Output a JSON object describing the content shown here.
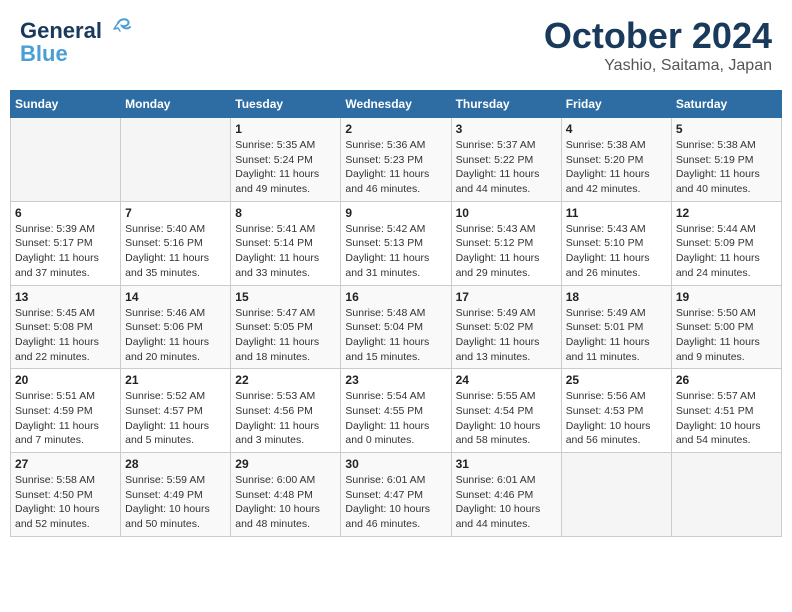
{
  "header": {
    "logo_line1": "General",
    "logo_line2": "Blue",
    "month": "October 2024",
    "location": "Yashio, Saitama, Japan"
  },
  "days_of_week": [
    "Sunday",
    "Monday",
    "Tuesday",
    "Wednesday",
    "Thursday",
    "Friday",
    "Saturday"
  ],
  "weeks": [
    [
      {
        "day": "",
        "info": ""
      },
      {
        "day": "",
        "info": ""
      },
      {
        "day": "1",
        "info": "Sunrise: 5:35 AM\nSunset: 5:24 PM\nDaylight: 11 hours and 49 minutes."
      },
      {
        "day": "2",
        "info": "Sunrise: 5:36 AM\nSunset: 5:23 PM\nDaylight: 11 hours and 46 minutes."
      },
      {
        "day": "3",
        "info": "Sunrise: 5:37 AM\nSunset: 5:22 PM\nDaylight: 11 hours and 44 minutes."
      },
      {
        "day": "4",
        "info": "Sunrise: 5:38 AM\nSunset: 5:20 PM\nDaylight: 11 hours and 42 minutes."
      },
      {
        "day": "5",
        "info": "Sunrise: 5:38 AM\nSunset: 5:19 PM\nDaylight: 11 hours and 40 minutes."
      }
    ],
    [
      {
        "day": "6",
        "info": "Sunrise: 5:39 AM\nSunset: 5:17 PM\nDaylight: 11 hours and 37 minutes."
      },
      {
        "day": "7",
        "info": "Sunrise: 5:40 AM\nSunset: 5:16 PM\nDaylight: 11 hours and 35 minutes."
      },
      {
        "day": "8",
        "info": "Sunrise: 5:41 AM\nSunset: 5:14 PM\nDaylight: 11 hours and 33 minutes."
      },
      {
        "day": "9",
        "info": "Sunrise: 5:42 AM\nSunset: 5:13 PM\nDaylight: 11 hours and 31 minutes."
      },
      {
        "day": "10",
        "info": "Sunrise: 5:43 AM\nSunset: 5:12 PM\nDaylight: 11 hours and 29 minutes."
      },
      {
        "day": "11",
        "info": "Sunrise: 5:43 AM\nSunset: 5:10 PM\nDaylight: 11 hours and 26 minutes."
      },
      {
        "day": "12",
        "info": "Sunrise: 5:44 AM\nSunset: 5:09 PM\nDaylight: 11 hours and 24 minutes."
      }
    ],
    [
      {
        "day": "13",
        "info": "Sunrise: 5:45 AM\nSunset: 5:08 PM\nDaylight: 11 hours and 22 minutes."
      },
      {
        "day": "14",
        "info": "Sunrise: 5:46 AM\nSunset: 5:06 PM\nDaylight: 11 hours and 20 minutes."
      },
      {
        "day": "15",
        "info": "Sunrise: 5:47 AM\nSunset: 5:05 PM\nDaylight: 11 hours and 18 minutes."
      },
      {
        "day": "16",
        "info": "Sunrise: 5:48 AM\nSunset: 5:04 PM\nDaylight: 11 hours and 15 minutes."
      },
      {
        "day": "17",
        "info": "Sunrise: 5:49 AM\nSunset: 5:02 PM\nDaylight: 11 hours and 13 minutes."
      },
      {
        "day": "18",
        "info": "Sunrise: 5:49 AM\nSunset: 5:01 PM\nDaylight: 11 hours and 11 minutes."
      },
      {
        "day": "19",
        "info": "Sunrise: 5:50 AM\nSunset: 5:00 PM\nDaylight: 11 hours and 9 minutes."
      }
    ],
    [
      {
        "day": "20",
        "info": "Sunrise: 5:51 AM\nSunset: 4:59 PM\nDaylight: 11 hours and 7 minutes."
      },
      {
        "day": "21",
        "info": "Sunrise: 5:52 AM\nSunset: 4:57 PM\nDaylight: 11 hours and 5 minutes."
      },
      {
        "day": "22",
        "info": "Sunrise: 5:53 AM\nSunset: 4:56 PM\nDaylight: 11 hours and 3 minutes."
      },
      {
        "day": "23",
        "info": "Sunrise: 5:54 AM\nSunset: 4:55 PM\nDaylight: 11 hours and 0 minutes."
      },
      {
        "day": "24",
        "info": "Sunrise: 5:55 AM\nSunset: 4:54 PM\nDaylight: 10 hours and 58 minutes."
      },
      {
        "day": "25",
        "info": "Sunrise: 5:56 AM\nSunset: 4:53 PM\nDaylight: 10 hours and 56 minutes."
      },
      {
        "day": "26",
        "info": "Sunrise: 5:57 AM\nSunset: 4:51 PM\nDaylight: 10 hours and 54 minutes."
      }
    ],
    [
      {
        "day": "27",
        "info": "Sunrise: 5:58 AM\nSunset: 4:50 PM\nDaylight: 10 hours and 52 minutes."
      },
      {
        "day": "28",
        "info": "Sunrise: 5:59 AM\nSunset: 4:49 PM\nDaylight: 10 hours and 50 minutes."
      },
      {
        "day": "29",
        "info": "Sunrise: 6:00 AM\nSunset: 4:48 PM\nDaylight: 10 hours and 48 minutes."
      },
      {
        "day": "30",
        "info": "Sunrise: 6:01 AM\nSunset: 4:47 PM\nDaylight: 10 hours and 46 minutes."
      },
      {
        "day": "31",
        "info": "Sunrise: 6:01 AM\nSunset: 4:46 PM\nDaylight: 10 hours and 44 minutes."
      },
      {
        "day": "",
        "info": ""
      },
      {
        "day": "",
        "info": ""
      }
    ]
  ]
}
